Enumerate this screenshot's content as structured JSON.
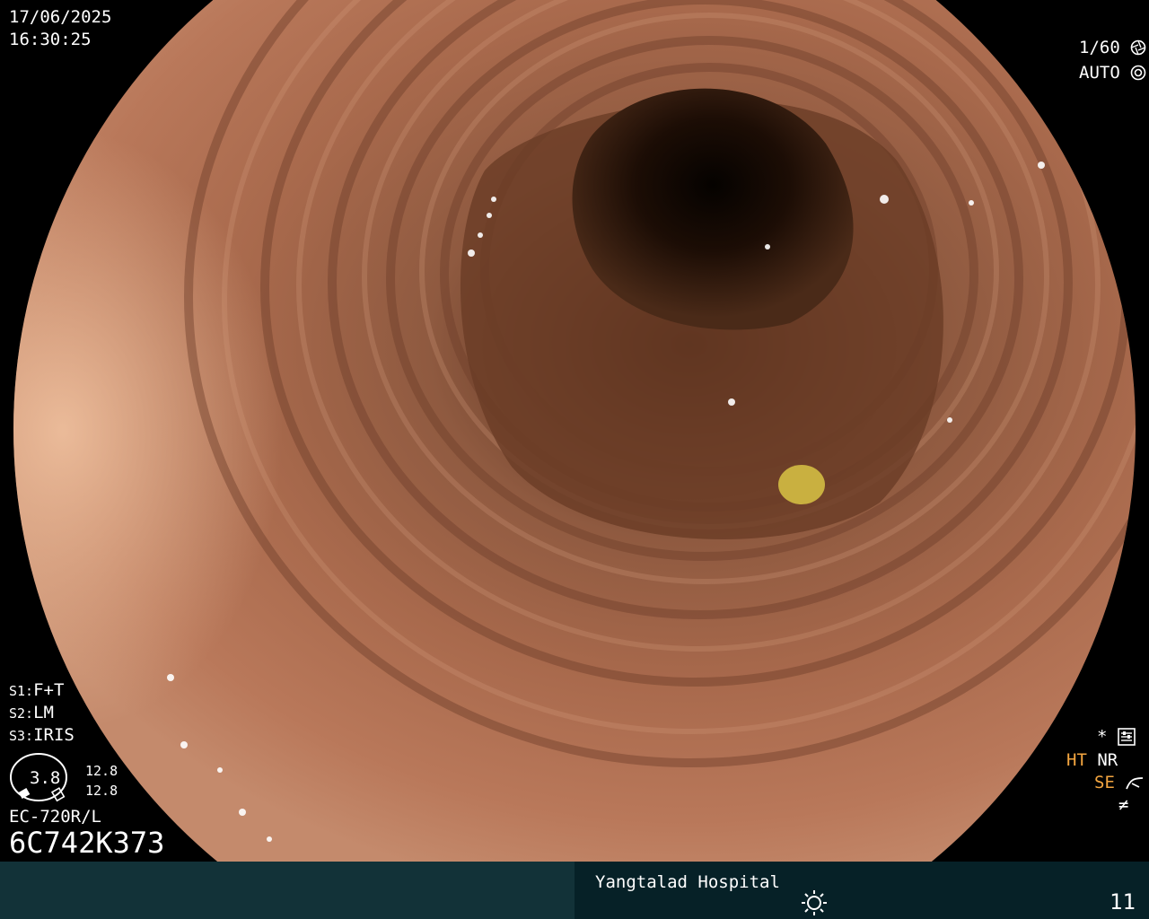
{
  "header": {
    "date": "17/06/2025",
    "time": "16:30:25"
  },
  "shutter": {
    "value": "1/60",
    "mode": "AUTO"
  },
  "settings": {
    "s1_label": "S1:",
    "s1_value": "F+T",
    "s2_label": "S2:",
    "s2_value": "LM",
    "s3_label": "S3:",
    "s3_value": "IRIS"
  },
  "gauge": {
    "center_value": "3.8",
    "upper_value": "12.8",
    "lower_value": "12.8"
  },
  "scope_info": {
    "model": "EC-720R/L",
    "serial": "6C742K373"
  },
  "right_indicators": {
    "star": "*",
    "ht": "HT",
    "nr": "NR",
    "se": "SE",
    "filter_symbol": "≠"
  },
  "footer": {
    "hospital": "Yangtalad Hospital",
    "number": "11"
  },
  "icons": [
    "aperture-icon",
    "auto-exposure-icon",
    "settings-sliders-icon",
    "enhancement-curve-icon",
    "brightness-icon",
    "gauge-scope-icon"
  ],
  "colors": {
    "accent_orange": "#f4a640",
    "footer_left": "#123238",
    "footer_right": "#062127",
    "tissue": "#b07556"
  }
}
